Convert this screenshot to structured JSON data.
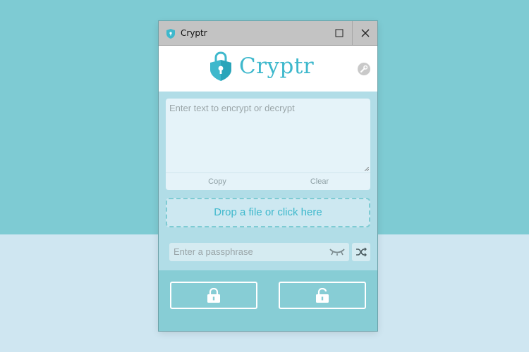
{
  "window": {
    "title": "Cryptr"
  },
  "header": {
    "logo_text": "Cryptr",
    "settings_icon": "wrench-icon"
  },
  "text_area": {
    "placeholder": "Enter text to encrypt or decrypt",
    "copy_label": "Copy",
    "clear_label": "Clear"
  },
  "drop_zone": {
    "label": "Drop a file or click here"
  },
  "passphrase": {
    "placeholder": "Enter a passphrase",
    "toggle_icon": "eye-closed-icon",
    "generate_icon": "shuffle-icon"
  },
  "actions": {
    "encrypt_icon": "lock-closed-icon",
    "decrypt_icon": "lock-open-icon"
  },
  "colors": {
    "accent": "#3eb8cc",
    "background_top": "#7ecbd3",
    "background_bottom": "#cfe6f1",
    "panel": "#b1dde7",
    "titlebar": "#c3c3c3"
  }
}
